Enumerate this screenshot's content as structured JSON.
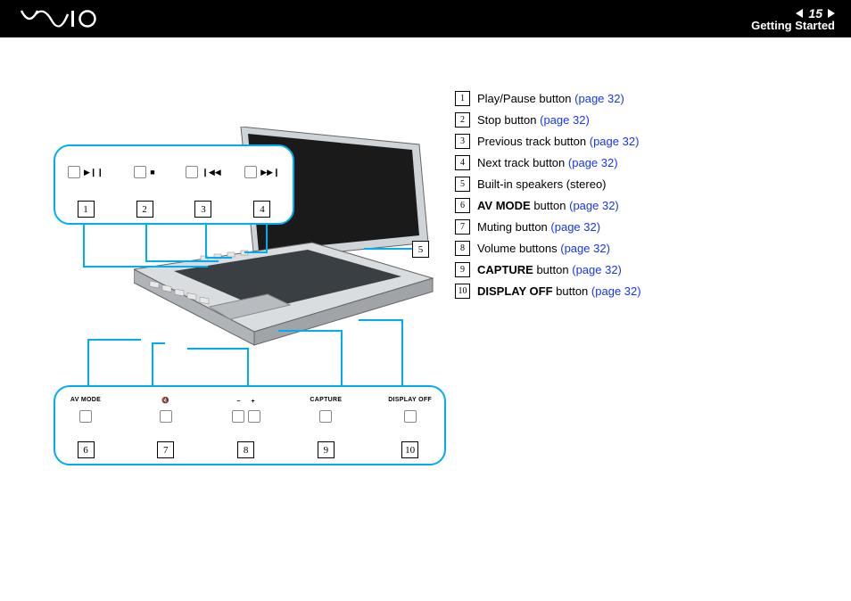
{
  "header": {
    "page_number": "15",
    "section": "Getting Started"
  },
  "features": [
    {
      "num": "1",
      "text": "Play/Pause button",
      "bold": "",
      "page": "(page 32)",
      "has_link": true
    },
    {
      "num": "2",
      "text": "Stop button",
      "bold": "",
      "page": "(page 32)",
      "has_link": true
    },
    {
      "num": "3",
      "text": "Previous track button",
      "bold": "",
      "page": "(page 32)",
      "has_link": true
    },
    {
      "num": "4",
      "text": "Next track button",
      "bold": "",
      "page": "(page 32)",
      "has_link": true
    },
    {
      "num": "5",
      "text": "Built-in speakers (stereo)",
      "bold": "",
      "page": "",
      "has_link": false
    },
    {
      "num": "6",
      "text": " button",
      "bold": "AV MODE",
      "page": "(page 32)",
      "has_link": true
    },
    {
      "num": "7",
      "text": "Muting button",
      "bold": "",
      "page": "(page 32)",
      "has_link": true
    },
    {
      "num": "8",
      "text": "Volume buttons",
      "bold": "",
      "page": "(page 32)",
      "has_link": true
    },
    {
      "num": "9",
      "text": " button",
      "bold": "CAPTURE",
      "page": "(page 32)",
      "has_link": true
    },
    {
      "num": "10",
      "text": " button",
      "bold": "DISPLAY OFF",
      "page": "(page 32)",
      "has_link": true
    }
  ],
  "callout_top": [
    {
      "num": "1",
      "glyph": "▶❙❙"
    },
    {
      "num": "2",
      "glyph": "■"
    },
    {
      "num": "3",
      "glyph": "❙◀◀"
    },
    {
      "num": "4",
      "glyph": "▶▶❙"
    }
  ],
  "callout_bottom": [
    {
      "num": "6",
      "label": "AV MODE",
      "buttons": 1
    },
    {
      "num": "7",
      "label": "",
      "buttons": 1,
      "glyph": "🔇"
    },
    {
      "num": "8",
      "label": "− 　 +",
      "buttons": 2
    },
    {
      "num": "9",
      "label": "CAPTURE",
      "buttons": 1
    },
    {
      "num": "10",
      "label": "DISPLAY OFF",
      "buttons": 1
    }
  ],
  "solo_callout": "5"
}
